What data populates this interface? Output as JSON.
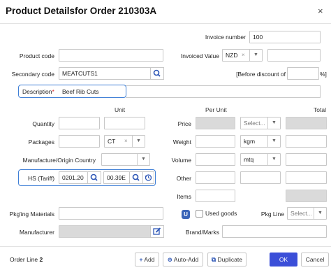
{
  "header": {
    "title": "Product Detailsfor Order 210303A",
    "close": "×"
  },
  "invoice": {
    "label": "Invoice number",
    "value": "100"
  },
  "product_code": {
    "label": "Product code",
    "value": ""
  },
  "invoiced_value": {
    "label": "Invoiced Value",
    "currency": "NZD",
    "clear": "×",
    "amount": ""
  },
  "secondary_code": {
    "label": "Secondary code",
    "value": "MEATCUTS1"
  },
  "discount": {
    "label": "[Before discount of",
    "value": "",
    "suffix": "%]"
  },
  "description": {
    "label": "Description",
    "required": "*",
    "value": "Beef Rib Cuts"
  },
  "columns": {
    "unit": "Unit",
    "per_unit": "Per Unit",
    "total": "Total"
  },
  "quantity": {
    "label": "Quantity",
    "value": "",
    "unit": ""
  },
  "packages": {
    "label": "Packages",
    "value": "",
    "unit": "CT",
    "clear": "×"
  },
  "manufacture": {
    "label": "Manufacture/Origin Country",
    "value": "",
    "country": ""
  },
  "hs": {
    "label": "HS (Tariff)",
    "code1": "0201.20",
    "code2": "00.39E"
  },
  "price": {
    "label": "Price",
    "value": "",
    "select_placeholder": "Select...",
    "total": ""
  },
  "weight": {
    "label": "Weight",
    "value": "",
    "unit": "kgm",
    "total": ""
  },
  "volume": {
    "label": "Volume",
    "value": "",
    "unit": "mtq",
    "total": ""
  },
  "other": {
    "label": "Other",
    "value": "",
    "unit": "",
    "total": ""
  },
  "items": {
    "label": "Items",
    "value": "",
    "total": ""
  },
  "pkg_materials": {
    "label": "Pkg'ing Materials",
    "value": ""
  },
  "used_goods": {
    "badge": "U",
    "label": "Used goods"
  },
  "pkg_line": {
    "label": "Pkg Line",
    "placeholder": "Select..."
  },
  "manufacturer": {
    "label": "Manufacturer",
    "value": ""
  },
  "brand_marks": {
    "label": "Brand/Marks",
    "value": ""
  },
  "footer": {
    "order_line_label": "Order Line",
    "order_line_value": "2",
    "add": "Add",
    "auto_add": "Auto-Add",
    "duplicate": "Duplicate",
    "ok": "OK",
    "cancel": "Cancel"
  },
  "colors": {
    "accent": "#3b4fd8",
    "highlight_border": "#3f7fd6",
    "icon_blue": "#2e57b6"
  }
}
